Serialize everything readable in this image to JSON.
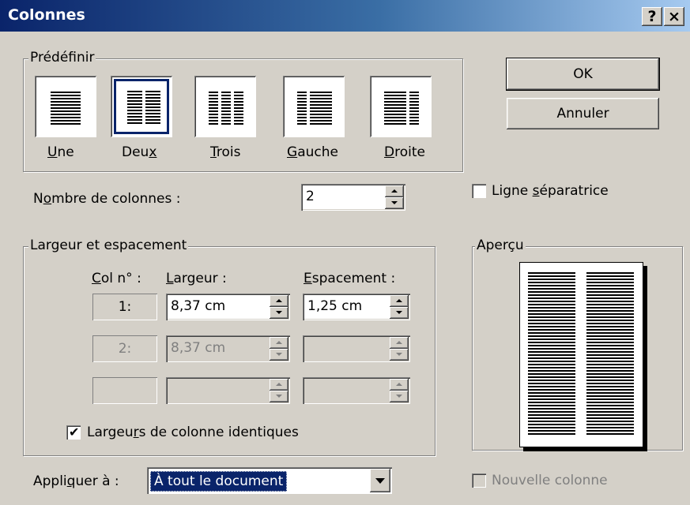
{
  "window": {
    "title": "Colonnes",
    "help_glyph": "?",
    "close_glyph": "×"
  },
  "buttons": {
    "ok": "OK",
    "cancel": "Annuler"
  },
  "presets": {
    "legend": "Prédéfinir",
    "items": [
      {
        "id": "une",
        "pre": "",
        "key": "U",
        "post": "ne",
        "selected": false
      },
      {
        "id": "deux",
        "pre": "Deu",
        "key": "x",
        "post": "",
        "selected": true
      },
      {
        "id": "trois",
        "pre": "",
        "key": "T",
        "post": "rois",
        "selected": false
      },
      {
        "id": "gauche",
        "pre": "",
        "key": "G",
        "post": "auche",
        "selected": false
      },
      {
        "id": "droite",
        "pre": "",
        "key": "D",
        "post": "roite",
        "selected": false
      }
    ]
  },
  "num_columns": {
    "label_pre": "N",
    "label_key": "o",
    "label_post": "mbre de colonnes :",
    "value": "2"
  },
  "separator": {
    "label_pre": "Ligne ",
    "label_key": "s",
    "label_post": "éparatrice",
    "checked": false
  },
  "width_spacing": {
    "legend": "Largeur et espacement",
    "col_header_key": "C",
    "col_header_post": "ol n° :",
    "width_header_key": "L",
    "width_header_post": "argeur :",
    "spacing_header_key": "E",
    "spacing_header_post": "spacement :",
    "rows": [
      {
        "col": "1:",
        "width": "8,37 cm",
        "spacing": "1,25 cm",
        "enabled": true
      },
      {
        "col": "2:",
        "width": "8,37 cm",
        "spacing": "",
        "enabled": false
      },
      {
        "col": "",
        "width": "",
        "spacing": "",
        "enabled": false
      }
    ],
    "equal_widths": {
      "label_pre": "Largeu",
      "label_key": "r",
      "label_post": "s de colonne identiques",
      "checked": true
    }
  },
  "preview": {
    "legend": "Aperçu"
  },
  "apply_to": {
    "label_pre": "Appli",
    "label_key": "q",
    "label_post": "uer à :",
    "value": "À tout le document"
  },
  "new_column": {
    "label": "Nouvelle colonne",
    "checked": false,
    "enabled": false
  }
}
